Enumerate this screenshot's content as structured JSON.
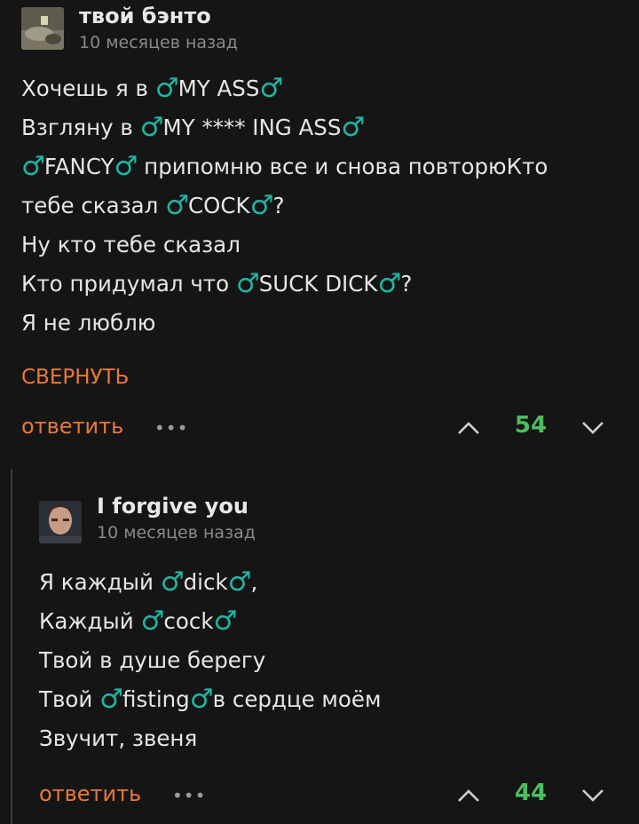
{
  "comments": [
    {
      "author": "твой бэнто",
      "time": "10 месяцев назад",
      "lines": [
        [
          "Хочешь я в ",
          "♂",
          "MY ASS",
          "♂",
          ""
        ],
        [
          "Взгляну в ",
          "♂",
          "MY **** ING ASS",
          "♂",
          ""
        ],
        [
          "",
          "♂",
          "FANCY",
          "♂",
          " припомню все и снова повторюКто"
        ],
        [
          "тебе сказал ",
          "♂",
          "COCK",
          "♂",
          "?"
        ],
        [
          "Ну кто тебе сказал",
          "",
          "",
          "",
          ""
        ],
        [
          "Кто придумал что ",
          "♂",
          "SUCK DICK",
          "♂",
          "?"
        ],
        [
          "Я не люблю",
          "",
          "",
          "",
          ""
        ]
      ],
      "collapse_label": "СВЕРНУТЬ",
      "reply_label": "ответить",
      "more_label": "•••",
      "score": "54"
    },
    {
      "author": "I forgive you",
      "time": "10 месяцев назад",
      "lines": [
        [
          "Я каждый ",
          "♂",
          "dick",
          "♂",
          ","
        ],
        [
          "Каждый ",
          "♂",
          "cock",
          "♂",
          ""
        ],
        [
          "Твой в душе берегу",
          "",
          "",
          "",
          ""
        ],
        [
          "Твой ",
          "♂",
          "fisting",
          "♂",
          "в сердце моём"
        ],
        [
          "Звучит, звеня",
          "",
          "",
          "",
          ""
        ]
      ],
      "reply_label": "ответить",
      "more_label": "•••",
      "score": "44"
    }
  ],
  "colors": {
    "accent": "#e8783a",
    "score": "#4dbd5e",
    "symbol": "#20b5a3"
  },
  "icons": {
    "vote_up": "chevron-up-icon",
    "vote_down": "chevron-down-icon",
    "more": "more-dots-icon"
  }
}
